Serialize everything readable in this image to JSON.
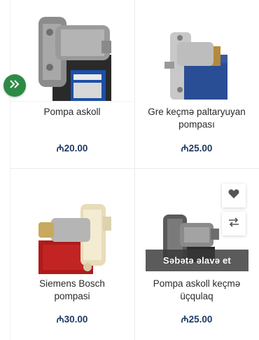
{
  "products": [
    {
      "title_line1": "Pompa askoll",
      "title_line2": "",
      "price": "₼20.00"
    },
    {
      "title_line1": "Gre keçmə paltaryuyan",
      "title_line2": "pompası",
      "price": "₼25.00"
    },
    {
      "title_line1": "Siemens Bosch",
      "title_line2": "pompasi",
      "price": "₼30.00"
    },
    {
      "title_line1": "Pompa askoll keçmə",
      "title_line2": "üçqulaq",
      "price": "₼25.00"
    }
  ],
  "actions": {
    "add_to_cart_label": "Səbətə əlavə et",
    "wishlist_icon": "heart-icon",
    "compare_icon": "compare-arrows-icon",
    "next_icon": "double-chevron-right-icon"
  },
  "colors": {
    "price": "#1e3a66",
    "nav_button": "#2d8a45",
    "pump_body_red": "#b01a1a",
    "pump_body_blue": "#2a4e96"
  }
}
